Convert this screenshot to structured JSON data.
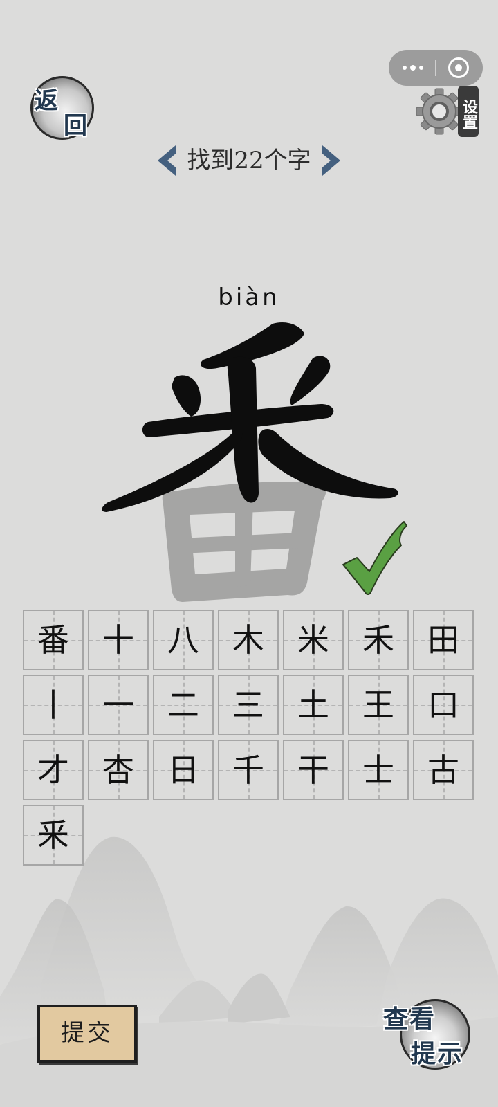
{
  "capsule": {
    "more_icon": "more-dots-icon",
    "close_icon": "record-circle-icon"
  },
  "back_button": {
    "char_top": "返",
    "char_bottom": "回"
  },
  "settings": {
    "label": "设置",
    "icon": "gear-icon"
  },
  "header": {
    "title": "找到22个字",
    "prev_icon": "chevron-left-icon",
    "next_icon": "chevron-right-icon"
  },
  "puzzle": {
    "pinyin": "biàn",
    "character": "番"
  },
  "found_characters": [
    "番",
    "十",
    "八",
    "木",
    "米",
    "禾",
    "田",
    "丨",
    "一",
    "二",
    "三",
    "土",
    "王",
    "口",
    "才",
    "杏",
    "日",
    "千",
    "干",
    "士",
    "古",
    "釆"
  ],
  "submit_button": {
    "label": "提交"
  },
  "hint_button": {
    "row1": "查看",
    "row2": "提示"
  },
  "colors": {
    "background": "#dcdcdb",
    "accent_blue": "#44607f",
    "check_green": "#5aa043",
    "ink": "#111111"
  }
}
